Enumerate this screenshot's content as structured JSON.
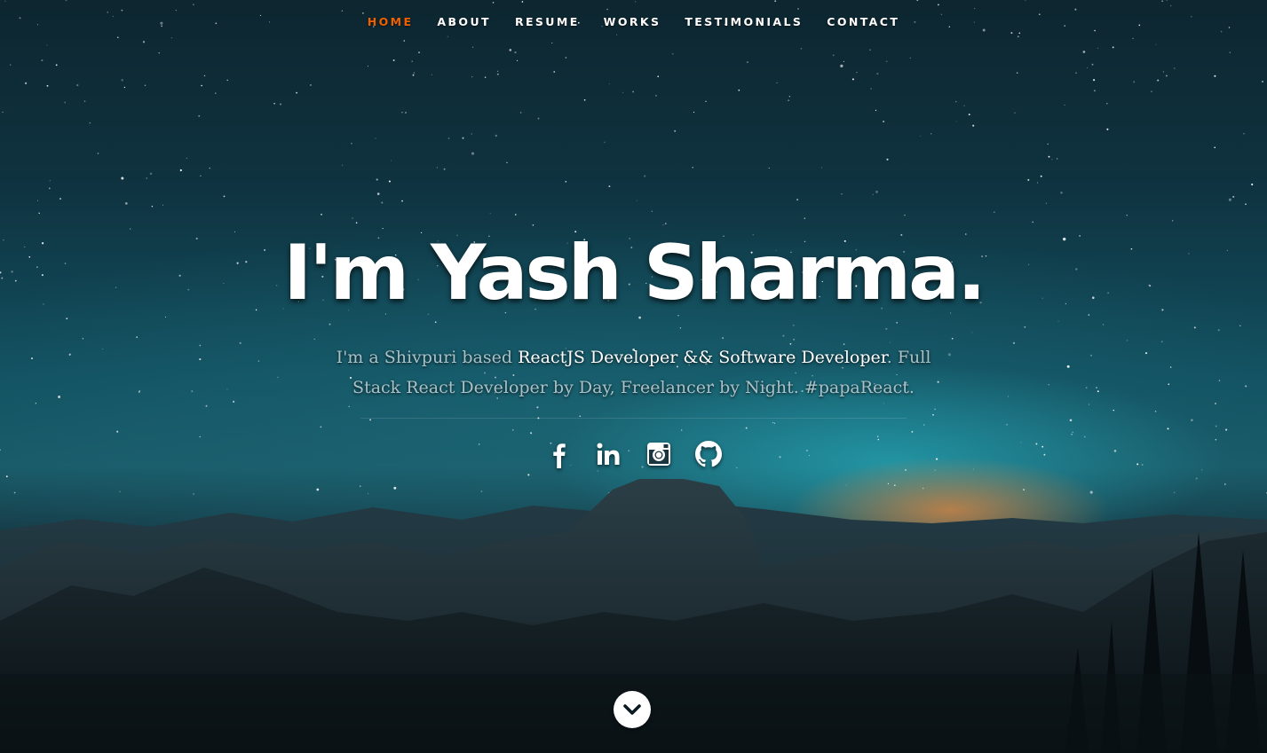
{
  "nav": {
    "items": [
      {
        "label": "HOME",
        "active": true
      },
      {
        "label": "ABOUT",
        "active": false
      },
      {
        "label": "RESUME",
        "active": false
      },
      {
        "label": "WORKS",
        "active": false
      },
      {
        "label": "TESTIMONIALS",
        "active": false
      },
      {
        "label": "CONTACT",
        "active": false
      }
    ],
    "active_color": "#f06000"
  },
  "hero": {
    "headline": "I'm Yash Sharma.",
    "intro_prefix": "I'm a Shivpuri based ",
    "intro_role": "ReactJS Developer && Software Developer",
    "intro_suffix": ". Full Stack React Developer by Day, Freelancer by Night. #papaReact."
  },
  "social": {
    "icons": [
      "facebook-icon",
      "linkedin-icon",
      "instagram-icon",
      "github-icon"
    ]
  },
  "scroll_down": {
    "icon": "chevron-down-icon"
  }
}
